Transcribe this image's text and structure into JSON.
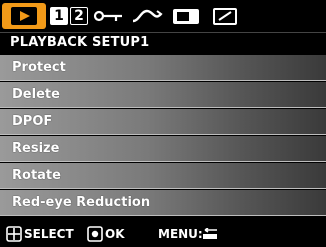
{
  "tabs": [
    {
      "icon": "play-icon",
      "active": true
    },
    {
      "label": "1",
      "selected": true
    },
    {
      "label": "2",
      "selected": false
    },
    {
      "icon": "key-icon"
    },
    {
      "icon": "wave-icon"
    },
    {
      "icon": "camera-display-icon"
    },
    {
      "icon": "screen-edit-icon"
    }
  ],
  "header": {
    "title": "PLAYBACK SETUP1"
  },
  "menu": {
    "items": [
      {
        "label": "Protect"
      },
      {
        "label": "Delete"
      },
      {
        "label": "DPOF"
      },
      {
        "label": "Resize"
      },
      {
        "label": "Rotate"
      },
      {
        "label": "Red-eye Reduction"
      }
    ]
  },
  "footer": {
    "select_label": "SELECT",
    "ok_label": "OK",
    "menu_label": "MENU:",
    "select_icon": "dpad-icon",
    "ok_icon": "ok-button-icon",
    "back_icon": "return-icon"
  },
  "colors": {
    "accent": "#f29a18",
    "item_light": "#9a9a9a",
    "item_dark": "#3a3a3a"
  }
}
